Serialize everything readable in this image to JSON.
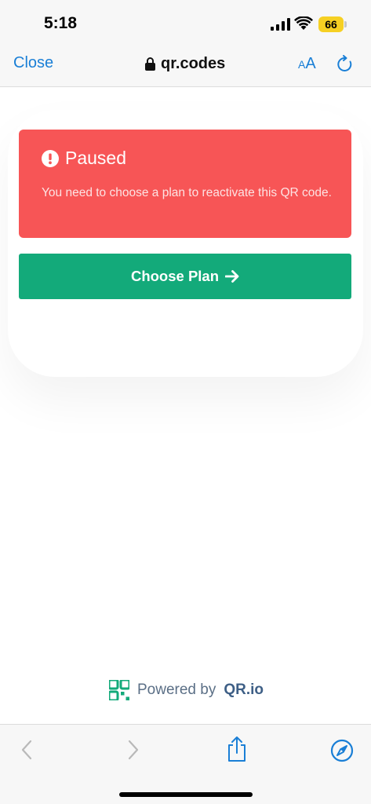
{
  "status_bar": {
    "time": "5:18",
    "battery": "66",
    "icons": [
      "signal-icon",
      "wifi-icon",
      "battery-icon"
    ]
  },
  "browser": {
    "close_label": "Close",
    "url": "qr.codes",
    "text_size_small": "A",
    "text_size_big": "A",
    "accent_color": "#1a7fd6"
  },
  "alert": {
    "title": "Paused",
    "message": "You need to choose a plan to reactivate this QR code.",
    "background_color": "#f75556",
    "icon": "exclamation-circle-icon"
  },
  "action": {
    "label": "Choose Plan",
    "icon": "arrow-right-icon",
    "background_color": "#13aa7a"
  },
  "footer": {
    "powered_text": "Powered by",
    "brand": "QR.io",
    "logo_icon": "qr-logo-icon"
  },
  "toolbar": {
    "icons": [
      "back-icon",
      "forward-icon",
      "share-icon",
      "compass-icon"
    ]
  }
}
